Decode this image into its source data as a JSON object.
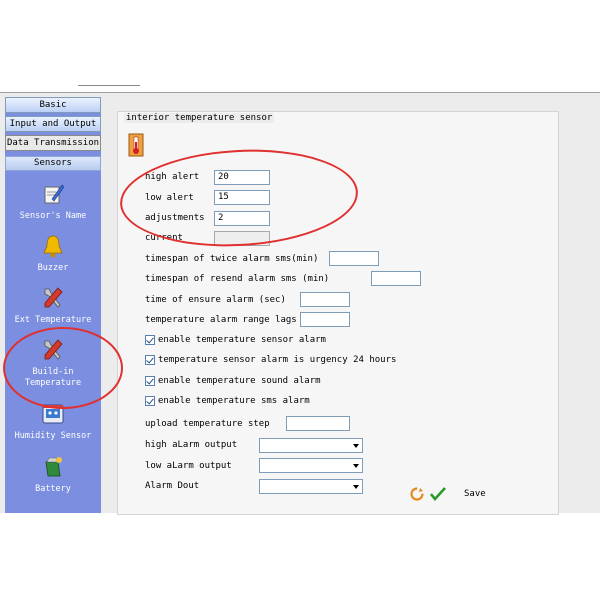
{
  "sidebar": {
    "tabs": [
      "Basic",
      "Input and Output",
      "Data Transmission"
    ],
    "section": "Sensors",
    "items": [
      {
        "label": "Sensor's Name",
        "icon": "pen-icon"
      },
      {
        "label": "Buzzer",
        "icon": "bell-icon"
      },
      {
        "label": "Ext Temperature",
        "icon": "wrench-icon"
      },
      {
        "label": "Build-in\nTemperature",
        "icon": "wrench-icon"
      },
      {
        "label": "Humidity Sensor",
        "icon": "humidity-icon"
      },
      {
        "label": "Battery",
        "icon": "battery-icon"
      }
    ]
  },
  "content": {
    "group_title": "interior temperature sensor",
    "fields": {
      "high_alert": {
        "label": "high alert",
        "value": "20"
      },
      "low_alert": {
        "label": "low alert",
        "value": "15"
      },
      "adjustments": {
        "label": "adjustments",
        "value": "2"
      },
      "current": {
        "label": "current",
        "value": ""
      },
      "timespan_twice": {
        "label": "timespan of twice alarm sms(min)",
        "value": ""
      },
      "timespan_resend": {
        "label": "timespan of resend alarm sms (min)",
        "value": ""
      },
      "time_ensure": {
        "label": "time of ensure alarm (sec)",
        "value": ""
      },
      "range_lags": {
        "label": "temperature alarm range lags",
        "value": ""
      },
      "upload_step": {
        "label": "upload temperature step",
        "value": ""
      }
    },
    "checkboxes": [
      {
        "label": "enable temperature sensor alarm",
        "checked": true
      },
      {
        "label": "temperature sensor alarm is urgency 24 hours",
        "checked": true
      },
      {
        "label": "enable temperature sound alarm",
        "checked": true
      },
      {
        "label": "enable temperature sms alarm",
        "checked": true
      }
    ],
    "selects": {
      "high_output": {
        "label": "high aLarm output",
        "value": ""
      },
      "low_output": {
        "label": "low aLarm output",
        "value": ""
      },
      "alarm_dout": {
        "label": "Alarm Dout",
        "value": ""
      }
    },
    "save_label": "Save"
  },
  "colors": {
    "sidebar_bg": "#7b8ee0",
    "annotation_red": "#e03030"
  }
}
